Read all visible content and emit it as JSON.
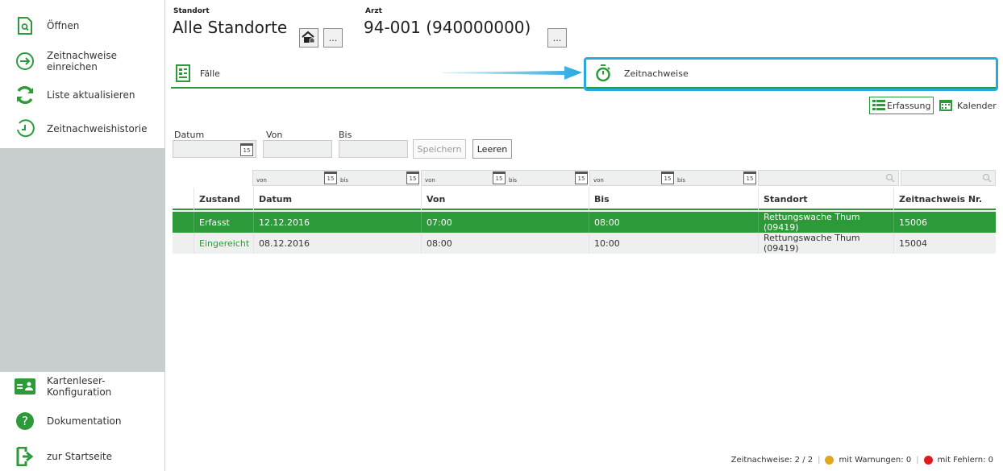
{
  "sidebar": {
    "items": [
      {
        "label": "Öffnen",
        "icon": "open-file-icon"
      },
      {
        "label": "Zeitnachweise einreichen",
        "icon": "arrow-right-circle-icon"
      },
      {
        "label": "Liste aktualisieren",
        "icon": "refresh-icon"
      },
      {
        "label": "Zeitnachweishistorie",
        "icon": "history-clock-icon"
      }
    ],
    "bottom_items": [
      {
        "label": "Kartenleser-Konfiguration",
        "icon": "card-reader-icon"
      },
      {
        "label": "Dokumentation",
        "icon": "help-icon"
      },
      {
        "label": "zur Startseite",
        "icon": "exit-icon"
      }
    ]
  },
  "header": {
    "standort_label": "Standort",
    "standort_value": "Alle Standorte",
    "arzt_label": "Arzt",
    "arzt_value": "94-001 (940000000)",
    "more_label": "..."
  },
  "tabs": [
    {
      "label": "Fälle",
      "icon": "document-list-icon"
    },
    {
      "label": "Zeitnachweise",
      "icon": "stopwatch-icon",
      "active": true
    }
  ],
  "view_toggle": {
    "erfassung": "Erfassung",
    "kalender": "Kalender"
  },
  "form": {
    "datum_label": "Datum",
    "von_label": "Von",
    "bis_label": "Bis",
    "speichern": "Speichern",
    "leeren": "Leeren",
    "cal_day": "15"
  },
  "filters": {
    "von": "von",
    "bis": "bis",
    "cal_day": "15"
  },
  "table": {
    "columns": [
      "Zustand",
      "Datum",
      "Von",
      "Bis",
      "Standort",
      "Zeitnachweis Nr."
    ],
    "rows": [
      {
        "zustand": "Erfasst",
        "datum": "12.12.2016",
        "von": "07:00",
        "bis": "08:00",
        "standort": "Rettungswache Thum (09419)",
        "nr": "15006",
        "selected": true
      },
      {
        "zustand": "Eingereicht",
        "datum": "08.12.2016",
        "von": "08:00",
        "bis": "10:00",
        "standort": "Rettungswache Thum (09419)",
        "nr": "15004",
        "selected": false
      }
    ]
  },
  "status": {
    "count_text": "Zeitnachweise: 2 / 2",
    "warnings_text": "mit Warnungen: 0",
    "errors_text": "mit Fehlern: 0",
    "warning_color": "#e0a81c",
    "error_color": "#e01b1b"
  },
  "colors": {
    "accent_green": "#2d9a3a",
    "highlight_blue": "#29a9df",
    "sidebar_gray": "#c8cdcd"
  }
}
